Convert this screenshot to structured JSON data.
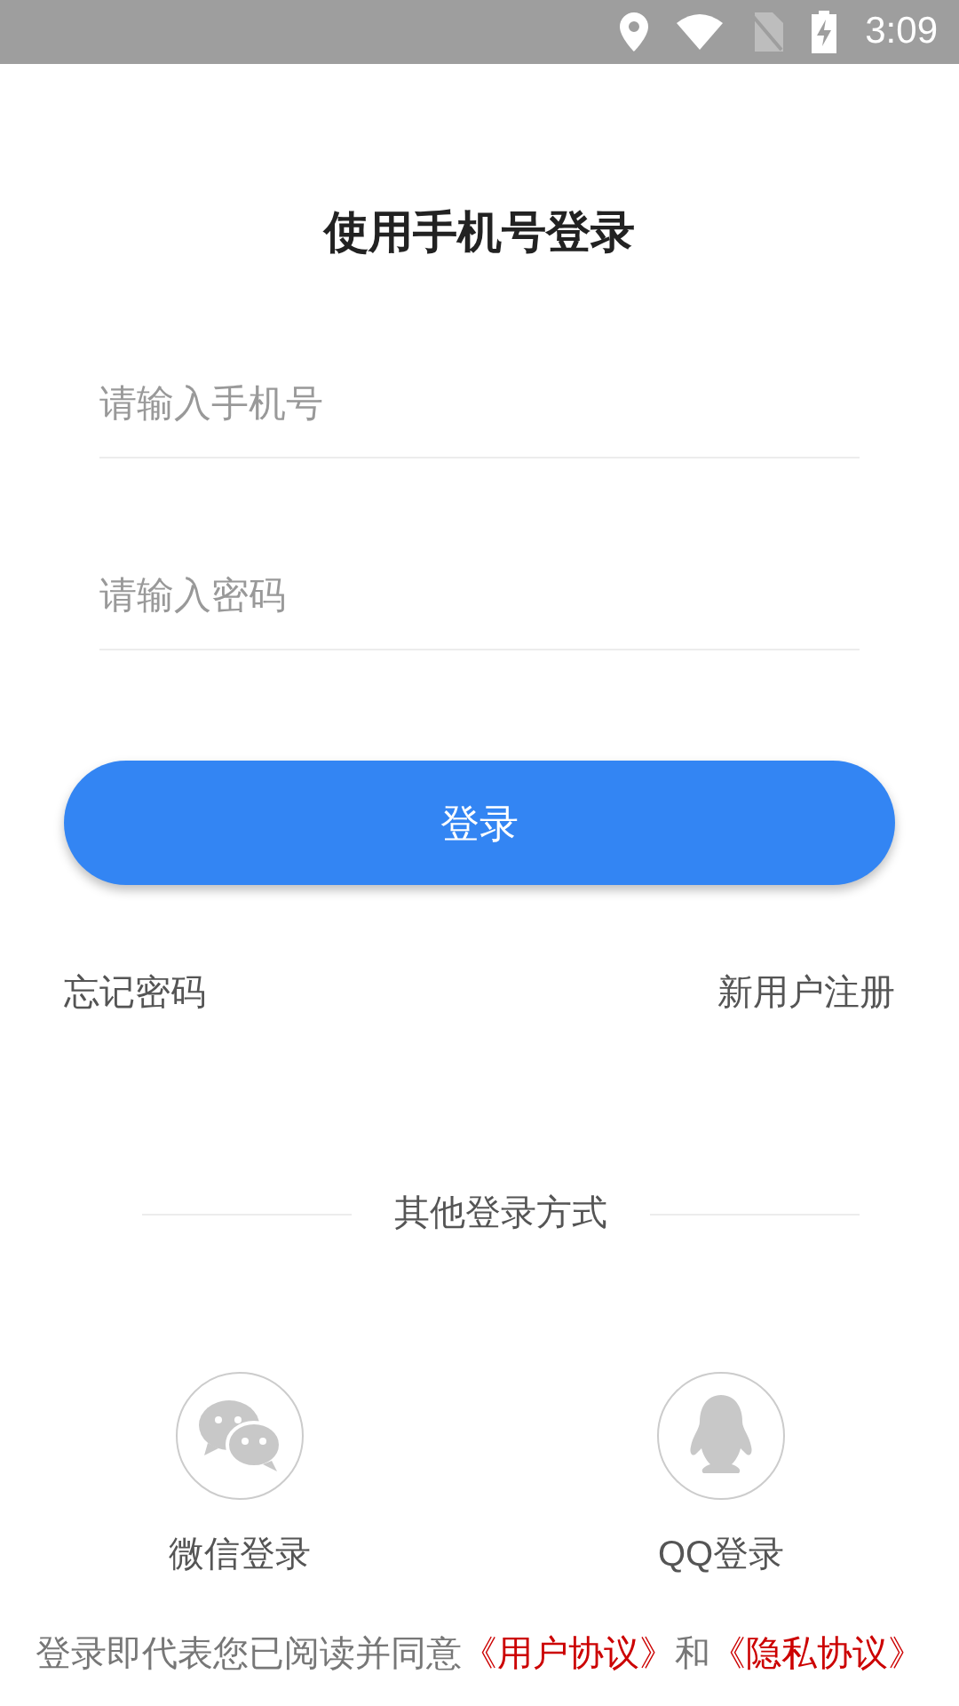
{
  "status_bar": {
    "time": "3:09"
  },
  "title": "使用手机号登录",
  "fields": [
    {
      "placeholder": "请输入手机号"
    },
    {
      "placeholder": "请输入密码"
    }
  ],
  "login_button": "登录",
  "forgot_password": "忘记密码",
  "register": "新用户注册",
  "other_login_heading": "其他登录方式",
  "social_logins": [
    {
      "kind": "wechat",
      "label": "微信登录"
    },
    {
      "kind": "qq",
      "label": "QQ登录"
    }
  ],
  "agreement": {
    "prefix": "登录即代表您已阅读并同意",
    "user_agreement": "《用户协议》",
    "conjunction": "和",
    "privacy_policy": "《隐私协议》"
  }
}
